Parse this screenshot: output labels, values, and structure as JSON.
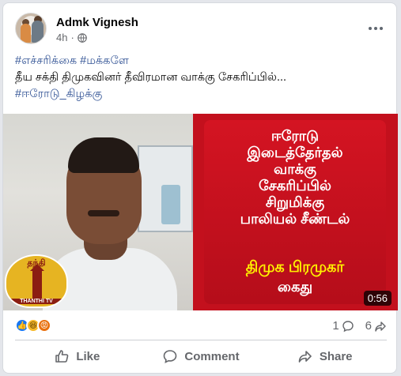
{
  "post": {
    "author": "Admk Vignesh",
    "time": "4h",
    "privacy_icon": "globe-icon",
    "more_icon": "more-horizontal-icon"
  },
  "content": {
    "hashtag_top": "#எச்சரிக்கை #மக்களே",
    "body": "தீய சக்தி திமுகவினர் தீவிரமான வாக்கு சேகரிப்பில்...",
    "hashtag_bottom": "#ஈரோடு_கிழக்கு"
  },
  "video": {
    "headline_lines": [
      "ஈரோடு",
      "இடைத்தேர்தல்",
      "வாக்கு",
      "சேகரிப்பில்",
      "சிறுமிக்கு",
      "பாலியல் சீண்டல்"
    ],
    "highlight": "திமுக பிரமுகர்",
    "tail": "கைது",
    "duration": "0:56",
    "logo_name": "தந்தி",
    "logo_sub": "THANTHI TV"
  },
  "stats": {
    "comments": "1",
    "shares": "6"
  },
  "actions": {
    "like": "Like",
    "comment": "Comment",
    "share": "Share"
  },
  "colors": {
    "hashtag": "#385898",
    "red_panel": "#c3101d",
    "highlight_yellow": "#fff200",
    "like_blue": "#1877f2"
  }
}
